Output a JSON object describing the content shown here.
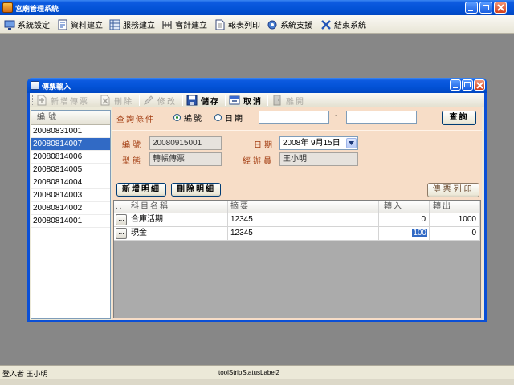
{
  "app": {
    "title": "宮廟管理系統"
  },
  "menu": [
    {
      "label": "系統設定",
      "icon": "settings-icon"
    },
    {
      "label": "資料建立",
      "icon": "data-entry-icon"
    },
    {
      "label": "服務建立",
      "icon": "service-icon"
    },
    {
      "label": "會計建立",
      "icon": "accounting-icon"
    },
    {
      "label": "報表列印",
      "icon": "report-print-icon"
    },
    {
      "label": "系統支援",
      "icon": "support-icon"
    },
    {
      "label": "結束系統",
      "icon": "exit-icon"
    }
  ],
  "child": {
    "title": "傳票輸入",
    "toolbar": [
      {
        "label": "新增傳票",
        "icon": "new-voucher-icon",
        "enabled": false
      },
      {
        "label": "刪除",
        "icon": "delete-icon",
        "enabled": false
      },
      {
        "label": "修改",
        "icon": "edit-icon",
        "enabled": false
      },
      {
        "label": "儲存",
        "icon": "save-icon",
        "enabled": true
      },
      {
        "label": "取消",
        "icon": "cancel-icon",
        "enabled": true
      },
      {
        "label": "離開",
        "icon": "leave-icon",
        "enabled": false
      }
    ],
    "list": {
      "header": "編號",
      "items": [
        "20080831001",
        "20080814007",
        "20080814006",
        "20080814005",
        "20080814004",
        "20080814003",
        "20080814002",
        "20080814001"
      ],
      "selected_index": 1
    },
    "query": {
      "label": "查詢條件",
      "options": [
        "編號",
        "日期"
      ],
      "selected_index": 0,
      "range_separator": "-",
      "button": "查詢"
    },
    "form": {
      "number_label": "編號",
      "number": "20080915001",
      "date_label": "日期",
      "date": "2008年 9月15日",
      "type_label": "型態",
      "type": "轉帳傳票",
      "clerk_label": "經辦員",
      "clerk": "王小明"
    },
    "actions": {
      "add_detail": "新增明細",
      "delete_detail": "刪除明細",
      "print_voucher": "傳票列印"
    },
    "grid": {
      "columns": [
        "..",
        "科目名稱",
        "摘要",
        "轉入",
        "轉出"
      ],
      "rows": [
        {
          "picker": "...",
          "account": "合庫活期",
          "memo": "12345",
          "in": "0",
          "out": "1000"
        },
        {
          "picker": "...",
          "account": "現金",
          "memo": "12345",
          "in": "100",
          "out": "0"
        }
      ]
    }
  },
  "status": {
    "login": "登入者 王小明",
    "label2": "toolStripStatusLabel2"
  },
  "colors": {
    "panel": "#f7ddc7",
    "label": "#a33d12",
    "selection": "#316ac5"
  }
}
